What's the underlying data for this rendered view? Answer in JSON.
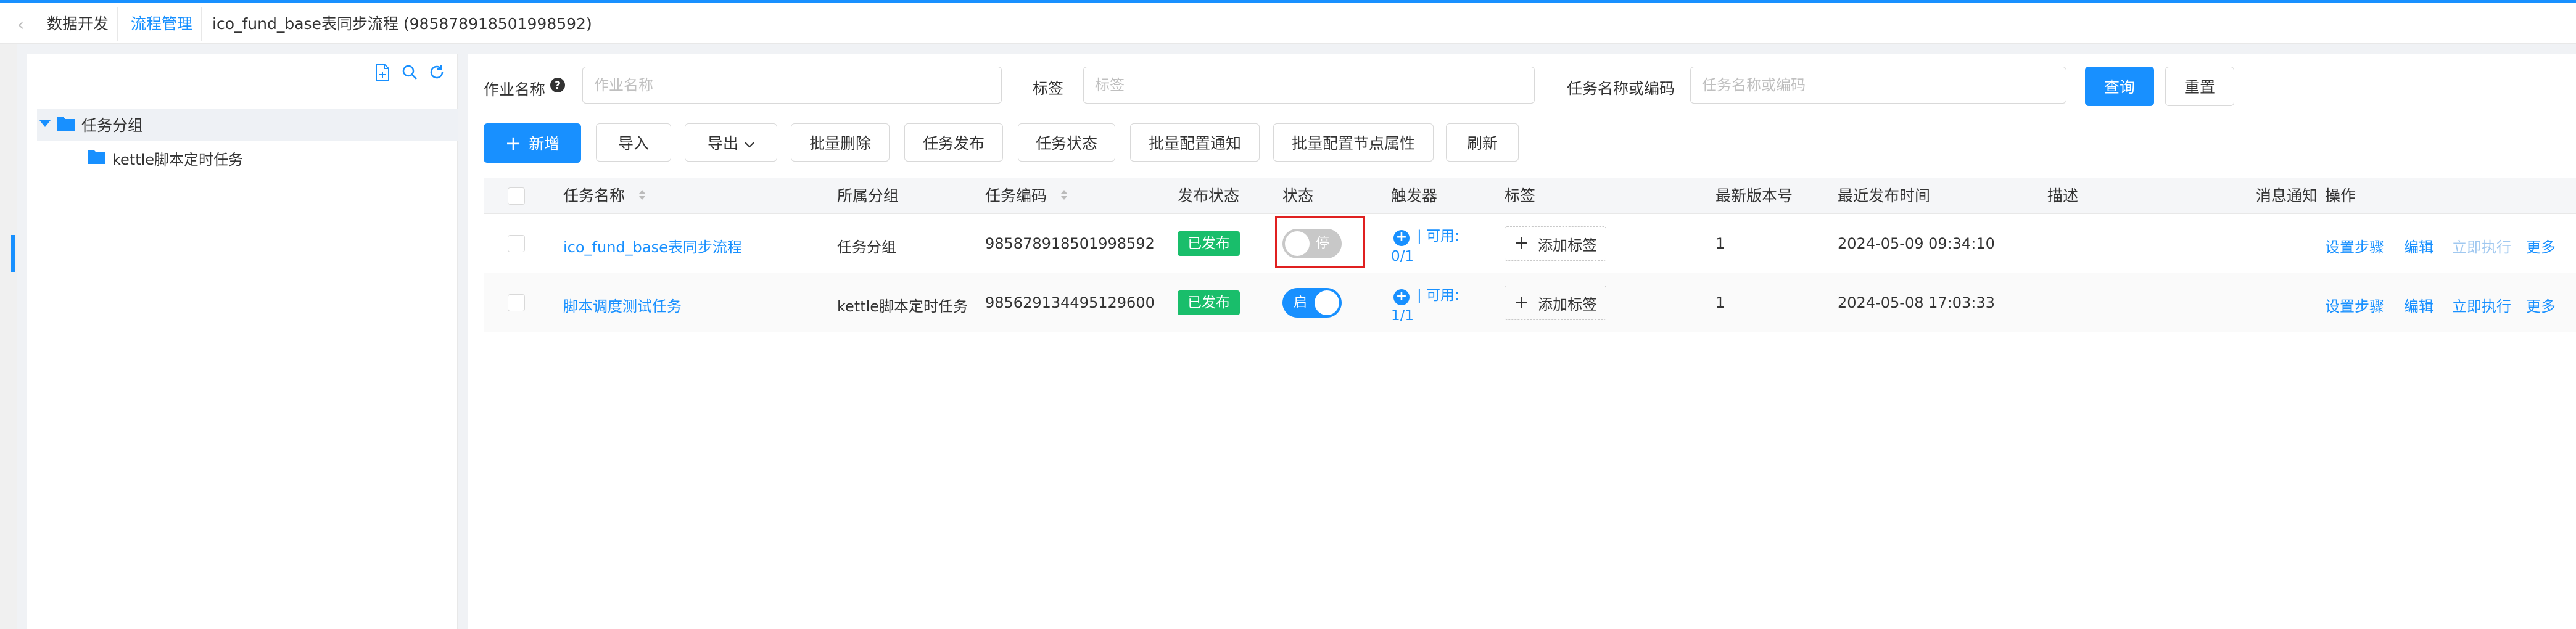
{
  "tabs": {
    "prev_arrow": "‹",
    "items": [
      {
        "label": "数据开发"
      },
      {
        "label": "流程管理"
      },
      {
        "label": "ico_fund_base表同步流程 (985878918501998592)"
      }
    ]
  },
  "sidebar": {
    "tools": [
      "add-file-icon",
      "search-icon",
      "refresh-icon"
    ],
    "tree": {
      "root_label": "任务分组",
      "child_label": "kettle脚本定时任务"
    }
  },
  "filters": {
    "job_name_label": "作业名称",
    "job_name_placeholder": "作业名称",
    "tag_label": "标签",
    "tag_placeholder": "标签",
    "task_label": "任务名称或编码",
    "task_placeholder": "任务名称或编码",
    "query_label": "查询",
    "reset_label": "重置"
  },
  "toolbar": {
    "add_label": "新增",
    "import_label": "导入",
    "export_label": "导出",
    "batch_delete_label": "批量删除",
    "publish_label": "任务发布",
    "status_label": "任务状态",
    "batch_notify_label": "批量配置通知",
    "batch_node_label": "批量配置节点属性",
    "refresh_label": "刷新"
  },
  "table": {
    "headers": {
      "name": "任务名称",
      "group": "所属分组",
      "code": "任务编码",
      "publish_status": "发布状态",
      "status": "状态",
      "trigger": "触发器",
      "tag": "标签",
      "version": "最新版本号",
      "publish_time": "最近发布时间",
      "desc": "描述",
      "notify": "消息通知",
      "ops": "操作"
    },
    "rows": [
      {
        "name": "ico_fund_base表同步流程",
        "group": "任务分组",
        "code": "985878918501998592",
        "publish_status": "已发布",
        "switch_text": "停",
        "switch_on": false,
        "trigger_available": "| 可用:",
        "trigger_count": "0/1",
        "add_tag": "添加标签",
        "version": "1",
        "publish_time": "2024-05-09 09:34:10",
        "ops": [
          "设置步骤",
          "编辑",
          "立即执行",
          "更多"
        ]
      },
      {
        "name": "脚本调度测试任务",
        "group": "kettle脚本定时任务",
        "code": "985629134495129600",
        "publish_status": "已发布",
        "switch_text": "启",
        "switch_on": true,
        "trigger_available": "| 可用:",
        "trigger_count": "1/1",
        "add_tag": "添加标签",
        "version": "1",
        "publish_time": "2024-05-08 17:03:33",
        "ops": [
          "设置步骤",
          "编辑",
          "立即执行",
          "更多"
        ]
      }
    ]
  },
  "colors": {
    "primary": "#1890ff",
    "success": "#19be6b",
    "highlight": "#e02020"
  }
}
